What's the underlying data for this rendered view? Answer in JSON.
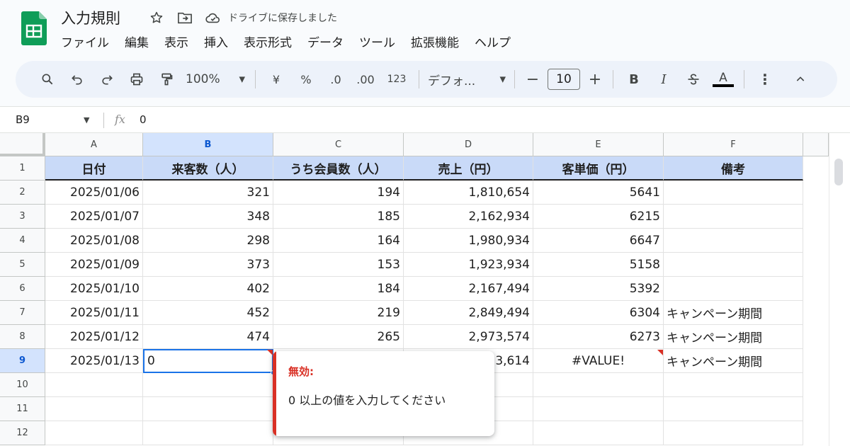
{
  "document": {
    "title": "入力規則",
    "save_status": "ドライブに保存しました"
  },
  "menu": [
    "ファイル",
    "編集",
    "表示",
    "挿入",
    "表示形式",
    "データ",
    "ツール",
    "拡張機能",
    "ヘルプ"
  ],
  "toolbar": {
    "zoom": "100%",
    "currency": "¥",
    "percent": "%",
    "dec_decrease": ".0",
    "dec_increase": ".00",
    "number_format": "123",
    "font": "デフォ...",
    "font_size": "10",
    "bold": "B",
    "italic": "I",
    "text_color": "A"
  },
  "formula_bar": {
    "cell_ref": "B9",
    "fx": "fx",
    "value": "0"
  },
  "sheet": {
    "columns": [
      "A",
      "B",
      "C",
      "D",
      "E",
      "F"
    ],
    "selected_column": "B",
    "selected_row": "9",
    "row_numbers": [
      "1",
      "2",
      "3",
      "4",
      "5",
      "6",
      "7",
      "8",
      "9",
      "10",
      "11",
      "12"
    ],
    "headers": [
      "日付",
      "来客数（人）",
      "うち会員数（人）",
      "売上（円）",
      "客単価（円）",
      "備考"
    ],
    "rows": [
      [
        "2025/01/06",
        "321",
        "194",
        "1,810,654",
        "5641",
        ""
      ],
      [
        "2025/01/07",
        "348",
        "185",
        "2,162,934",
        "6215",
        ""
      ],
      [
        "2025/01/08",
        "298",
        "164",
        "1,980,934",
        "6647",
        ""
      ],
      [
        "2025/01/09",
        "373",
        "153",
        "1,923,934",
        "5158",
        ""
      ],
      [
        "2025/01/10",
        "402",
        "184",
        "2,167,494",
        "5392",
        ""
      ],
      [
        "2025/01/11",
        "452",
        "219",
        "2,849,494",
        "6304",
        "キャンペーン期間"
      ],
      [
        "2025/01/12",
        "474",
        "265",
        "2,973,574",
        "6273",
        "キャンペーン期間"
      ],
      [
        "2025/01/13",
        "0",
        "",
        "53,614",
        "#VALUE!",
        "キャンペーン期間"
      ]
    ]
  },
  "validation_popup": {
    "title": "無効:",
    "message": "0 以上の値を入力してください"
  },
  "colors": {
    "accent": "#1a73e8",
    "error": "#d93025",
    "header_fill": "#c9daf8",
    "sheets_green": "#0f9d58"
  }
}
